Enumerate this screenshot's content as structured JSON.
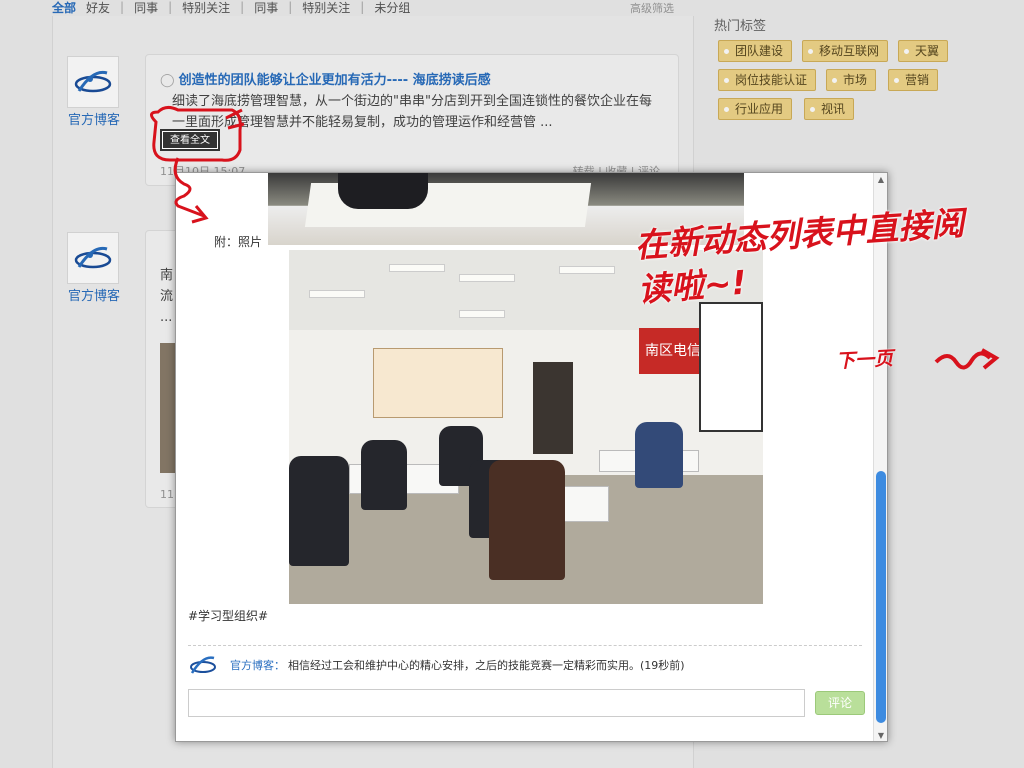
{
  "topbar": {
    "tabs": [
      "全部",
      "好友",
      "同事",
      "特别关注",
      "同事",
      "特别关注",
      "未分组"
    ],
    "advanced_filter": "高级筛选"
  },
  "feed": {
    "items": [
      {
        "author": "官方博客",
        "title": "创造性的团队能够让企业更加有活力---- 海底捞读后感",
        "body": "细读了海底捞管理智慧，从一个街边的\"串串\"分店到开到全国连锁性的餐饮企业在每一里面形成管理智慧并不能轻易复制，成功的管理运作和经营管 ...",
        "date": "11月10日 15:07",
        "meta": "转载 | 收藏 | 评论"
      },
      {
        "author": "官方博客",
        "body_lines": [
          "南",
          "流",
          "..."
        ],
        "date": "11"
      }
    ],
    "read_full_button": "查看全文"
  },
  "sidebar": {
    "title": "热门标签",
    "tags": [
      "团队建设",
      "移动互联网",
      "天翼",
      "岗位技能认证",
      "市场",
      "营销",
      "行业应用",
      "视讯"
    ]
  },
  "modal": {
    "attachment_label": "附：照片",
    "photo_banner_text": "南区电信局",
    "hashtag": "#学习型组织#",
    "comment": {
      "author": "官方博客：",
      "text": "相信经过工会和维护中心的精心安排，之后的技能竞赛一定精彩而实用。(19秒前)"
    },
    "comment_button": "评论",
    "comment_placeholder": ""
  },
  "annotations": {
    "main_note": "在新动态列表中直接阅读啦~!",
    "next_page": "下一页",
    "color": "#d8121c"
  }
}
